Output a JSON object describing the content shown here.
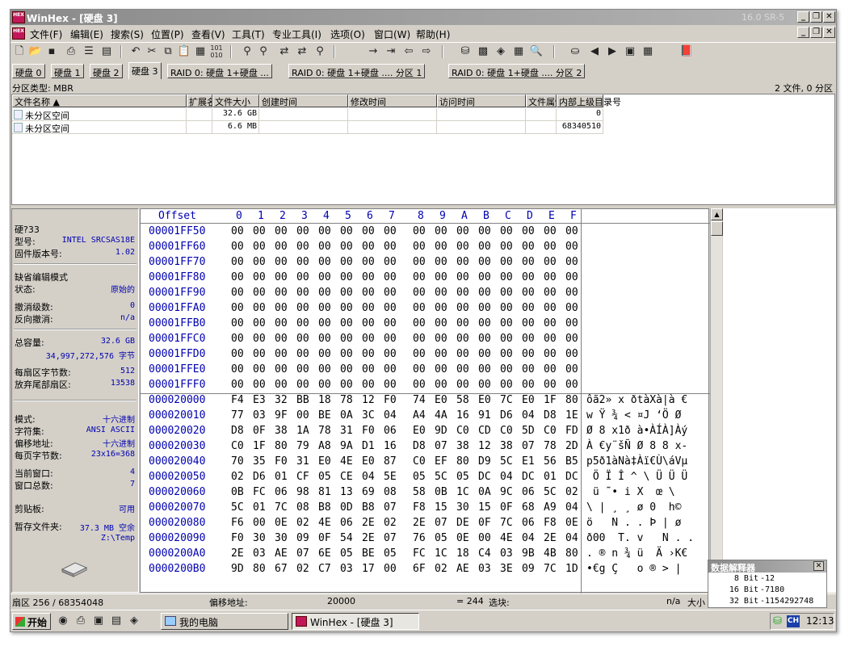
{
  "window": {
    "title": "WinHex - [硬盘 3]",
    "version": "16.0 SR-5",
    "app_icon_text": "HEX"
  },
  "menu": [
    "文件(F)",
    "编辑(E)",
    "搜索(S)",
    "位置(P)",
    "查看(V)",
    "工具(T)",
    "专业工具(I)",
    "选项(O)",
    "窗口(W)",
    "帮助(H)"
  ],
  "tabs": [
    "硬盘 0",
    "硬盘 1",
    "硬盘 2",
    "硬盘 3",
    "RAID 0: 硬盘 1+硬盘 ...",
    "RAID 0: 硬盘 1+硬盘 .... 分区 1",
    "RAID 0: 硬盘 1+硬盘 .... 分区 2"
  ],
  "active_tab": 3,
  "info": {
    "left": "分区类型: MBR",
    "right": "2 文件, 0 分区"
  },
  "file_columns": [
    "文件名称 ▲",
    "扩展名",
    "文件大小",
    "创建时间",
    "修改时间",
    "访问时间",
    "文件属性",
    "内部上级目录号"
  ],
  "files": [
    {
      "name": "未分区空间",
      "size": "32.6 GB",
      "dir": "0"
    },
    {
      "name": "未分区空间",
      "size": "6.6 MB",
      "dir": "68340510"
    }
  ],
  "side": {
    "disk_label": "硬?33",
    "model_label": "型号:",
    "model": "INTEL   SRCSAS18E",
    "fw_label": "固件版本号:",
    "fw": "1.02",
    "mode_title": "缺省编辑模式",
    "state_label": "状态:",
    "state": "原始的",
    "undo_label": "撤消级数:",
    "undo": "0",
    "redo_label": "反向撤消:",
    "redo": "n/a",
    "cap_label": "总容量:",
    "cap": "32.6 GB",
    "bytes": "34,997,272,576 字节",
    "bps_label": "每扇区字节数:",
    "bps": "512",
    "spare_label": "放弃尾部扇区:",
    "spare": "13538",
    "mode_label": "模式:",
    "mode": "十六进制",
    "charset_label": "字符集:",
    "charset": "ANSI ASCII",
    "offset_label": "偏移地址:",
    "offset": "十六进制",
    "bpp_label": "每页字节数:",
    "bpp": "23x16=368",
    "curwin_label": "当前窗口:",
    "curwin": "4",
    "totwin_label": "窗口总数:",
    "totwin": "7",
    "clip_label": "剪贴板:",
    "clip": "可用",
    "temp_label": "暂存文件夹:",
    "temp": "37.3 MB 空余",
    "temp_path": "Z:\\Temp"
  },
  "hex": {
    "offset_header": "Offset",
    "col_headers": [
      "0",
      "1",
      "2",
      "3",
      "4",
      "5",
      "6",
      "7",
      "8",
      "9",
      "A",
      "B",
      "C",
      "D",
      "E",
      "F"
    ],
    "rows": [
      {
        "off": "00001FF50",
        "bytes": "00 00 00 00 00 00 00 00 00 00 00 00 00 00 00 00",
        "ascii": ""
      },
      {
        "off": "00001FF60",
        "bytes": "00 00 00 00 00 00 00 00 00 00 00 00 00 00 00 00",
        "ascii": ""
      },
      {
        "off": "00001FF70",
        "bytes": "00 00 00 00 00 00 00 00 00 00 00 00 00 00 00 00",
        "ascii": ""
      },
      {
        "off": "00001FF80",
        "bytes": "00 00 00 00 00 00 00 00 00 00 00 00 00 00 00 00",
        "ascii": ""
      },
      {
        "off": "00001FF90",
        "bytes": "00 00 00 00 00 00 00 00 00 00 00 00 00 00 00 00",
        "ascii": ""
      },
      {
        "off": "00001FFA0",
        "bytes": "00 00 00 00 00 00 00 00 00 00 00 00 00 00 00 00",
        "ascii": ""
      },
      {
        "off": "00001FFB0",
        "bytes": "00 00 00 00 00 00 00 00 00 00 00 00 00 00 00 00",
        "ascii": ""
      },
      {
        "off": "00001FFC0",
        "bytes": "00 00 00 00 00 00 00 00 00 00 00 00 00 00 00 00",
        "ascii": ""
      },
      {
        "off": "00001FFD0",
        "bytes": "00 00 00 00 00 00 00 00 00 00 00 00 00 00 00 00",
        "ascii": ""
      },
      {
        "off": "00001FFE0",
        "bytes": "00 00 00 00 00 00 00 00 00 00 00 00 00 00 00 00",
        "ascii": ""
      },
      {
        "off": "00001FFF0",
        "bytes": "00 00 00 00 00 00 00 00 00 00 00 00 00 00 00 00",
        "ascii": ""
      },
      {
        "off": "000020000",
        "bytes": "F4 E3 32 BB 18 78 12 F0 74 E0 58 E0 7C E0 1F 80",
        "ascii": "ôã2» x ðtàXà|à €"
      },
      {
        "off": "000020010",
        "bytes": "77 03 9F 00 BE 0A 3C 04 A4 4A 16 91 D6 04 D8 1E",
        "ascii": "w Ÿ ¾ < ¤J ‘Ö Ø"
      },
      {
        "off": "000020020",
        "bytes": "D8 0F 38 1A 78 31 F0 06 E0 9D C0 CD C0 5D C0 FD",
        "ascii": "Ø 8 x1ð à•ÀÍÀ]Àý"
      },
      {
        "off": "000020030",
        "bytes": "C0 1F 80 79 A8 9A D1 16 D8 07 38 12 38 07 78 2D",
        "ascii": "À €y¨šÑ Ø 8 8 x-"
      },
      {
        "off": "000020040",
        "bytes": "70 35 F0 31 E0 4E E0 87 C0 EF 80 D9 5C E1 56 B5",
        "ascii": "p5ð1àNà‡Àï€Ù\\áVµ"
      },
      {
        "off": "000020050",
        "bytes": "02 D6 01 CF 05 CE 04 5E 05 5C 05 DC 04 DC 01 DC",
        "ascii": " Ö Ï Î ^ \\ Ü Ü Ü"
      },
      {
        "off": "000020060",
        "bytes": "0B FC 06 98 81 13 69 08 58 0B 1C 0A 9C 06 5C 02",
        "ascii": " ü ˜• i X  œ \\"
      },
      {
        "off": "000020070",
        "bytes": "5C 01 7C 08 B8 0D B8 07 F8 15 30 15 0F 68 A9 04",
        "ascii": "\\ | ¸ ¸ ø 0  h©"
      },
      {
        "off": "000020080",
        "bytes": "F6 00 0E 02 4E 06 2E 02 2E 07 DE 0F 7C 06 F8 0E",
        "ascii": "ö   N . . Þ | ø"
      },
      {
        "off": "000020090",
        "bytes": "F0 30 30 09 0F 54 2E 07 76 05 0E 00 4E 04 2E 04",
        "ascii": "ð00  T. v   N . ."
      },
      {
        "off": "0000200A0",
        "bytes": "2E 03 AE 07 6E 05 BE 05 FC 1C 18 C4 03 9B 4B 80",
        "ascii": ". ® n ¾ ü  Ä ›K€"
      },
      {
        "off": "0000200B0",
        "bytes": "9D 80 67 02 C7 03 17 00 6F 02 AE 03 3E 09 7C 1D",
        "ascii": "•€g Ç   o ® > |"
      }
    ]
  },
  "interpreter": {
    "title": "数据解释器",
    "rows": [
      {
        "label": "8 Bit",
        "value": "-12"
      },
      {
        "label": "16 Bit",
        "value": "-7180"
      },
      {
        "label": "32 Bit",
        "value": "-1154292748"
      }
    ]
  },
  "status": {
    "sector": "扇区 256 / 68354048",
    "offset_label": "偏移地址:",
    "offset_value": "20000",
    "eq": "= 244",
    "block_label": "选块:",
    "na": "n/a",
    "size_label": "大小"
  },
  "taskbar": {
    "start": "开始",
    "tasks": [
      "我的电脑",
      "WinHex - [硬盘 3]"
    ],
    "ime": "CH",
    "clock": "12:13"
  }
}
